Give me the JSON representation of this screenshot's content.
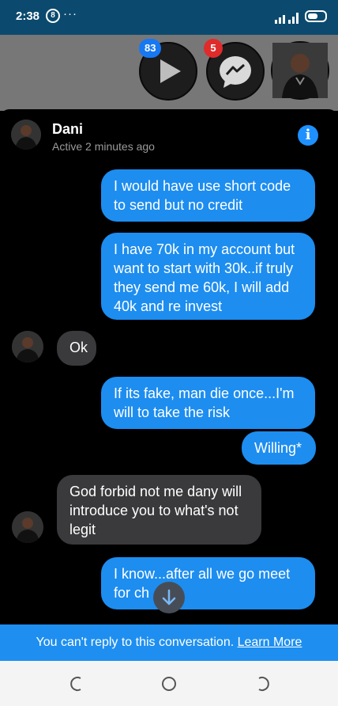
{
  "status_bar": {
    "time": "2:38",
    "badge": "8",
    "dots": "···"
  },
  "chat_heads": {
    "youtube_count": "83",
    "messenger_count": "5",
    "icons": [
      "play-icon",
      "messenger-icon",
      "avatar"
    ]
  },
  "conversation": {
    "contact_name": "Dani",
    "contact_status": "Active 2 minutes ago",
    "info_label": "i",
    "messages": [
      {
        "direction": "sent",
        "text": "I would have use short code to send but no credit"
      },
      {
        "direction": "sent",
        "text": "I have 70k in my account but want to start with 30k..if truly they send me 60k, I will add 40k and re invest"
      },
      {
        "direction": "received",
        "text": "Ok"
      },
      {
        "direction": "sent",
        "text": "If its fake, man die once...I'm will to take the risk"
      },
      {
        "direction": "sent",
        "text": "Willing*"
      },
      {
        "direction": "received",
        "text": "God forbid not me dany will introduce you to what's not legit"
      },
      {
        "direction": "sent",
        "text": "I know...after all we go meet for ch   ..."
      }
    ]
  },
  "notice": {
    "text": "You can't reply to this conversation.",
    "link": "Learn More"
  },
  "colors": {
    "sent_bubble": "#1d8df0",
    "received_bubble": "#3a3a3c",
    "status_bar": "#0b4a6e",
    "notice_bar": "#1e8ff0"
  }
}
